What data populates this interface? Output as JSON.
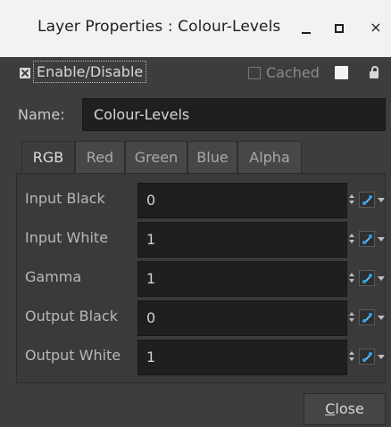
{
  "window": {
    "title": "Layer Properties : Colour-Levels",
    "close_glyph": "×"
  },
  "options": {
    "enable_label": "Enable/Disable",
    "enable_checked": true,
    "cached_label": "Cached",
    "cached_checked": false,
    "swatch_color": "#f4f4f4"
  },
  "name": {
    "label": "Name:",
    "value": "Colour-Levels"
  },
  "tabs": [
    {
      "label": "RGB",
      "active": true
    },
    {
      "label": "Red",
      "active": false
    },
    {
      "label": "Green",
      "active": false
    },
    {
      "label": "Blue",
      "active": false
    },
    {
      "label": "Alpha",
      "active": false
    }
  ],
  "params": [
    {
      "label": "Input Black",
      "value": "0"
    },
    {
      "label": "Input White",
      "value": "1"
    },
    {
      "label": "Gamma",
      "value": "1"
    },
    {
      "label": "Output Black",
      "value": "0"
    },
    {
      "label": "Output White",
      "value": "1"
    }
  ],
  "close_button": {
    "mnemonic": "C",
    "rest": "lose"
  }
}
